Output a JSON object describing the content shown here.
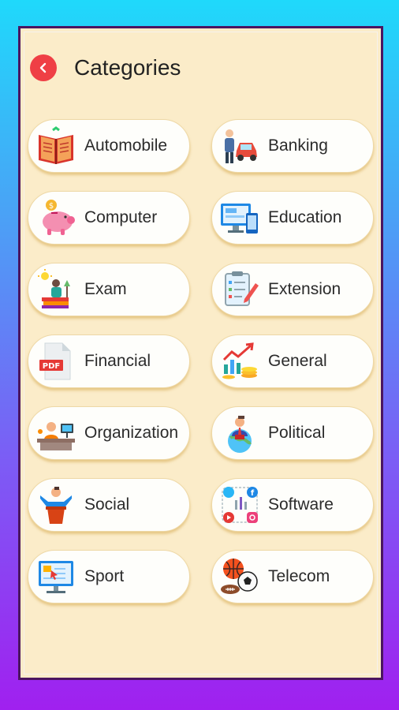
{
  "header": {
    "title": "Categories",
    "back_icon": "chevron-left-icon"
  },
  "colors": {
    "accent": "#ef3f45",
    "panel": "#fbecc9",
    "frame": "#4b1560"
  },
  "categories": [
    {
      "label": "Automobile",
      "icon": "book-icon"
    },
    {
      "label": "Banking",
      "icon": "car-person-icon"
    },
    {
      "label": "Computer",
      "icon": "piggy-bank-icon"
    },
    {
      "label": "Education",
      "icon": "monitor-icon"
    },
    {
      "label": "Exam",
      "icon": "study-icon"
    },
    {
      "label": "Extension",
      "icon": "clipboard-pen-icon"
    },
    {
      "label": "Financial",
      "icon": "pdf-icon"
    },
    {
      "label": "General",
      "icon": "growth-chart-icon"
    },
    {
      "label": "Organization",
      "icon": "desk-worker-icon"
    },
    {
      "label": "Political",
      "icon": "globe-leader-icon"
    },
    {
      "label": "Social",
      "icon": "speaker-podium-icon"
    },
    {
      "label": "Software",
      "icon": "social-apps-icon"
    },
    {
      "label": "Sport",
      "icon": "presentation-board-icon"
    },
    {
      "label": "Telecom",
      "icon": "sports-balls-icon"
    }
  ]
}
